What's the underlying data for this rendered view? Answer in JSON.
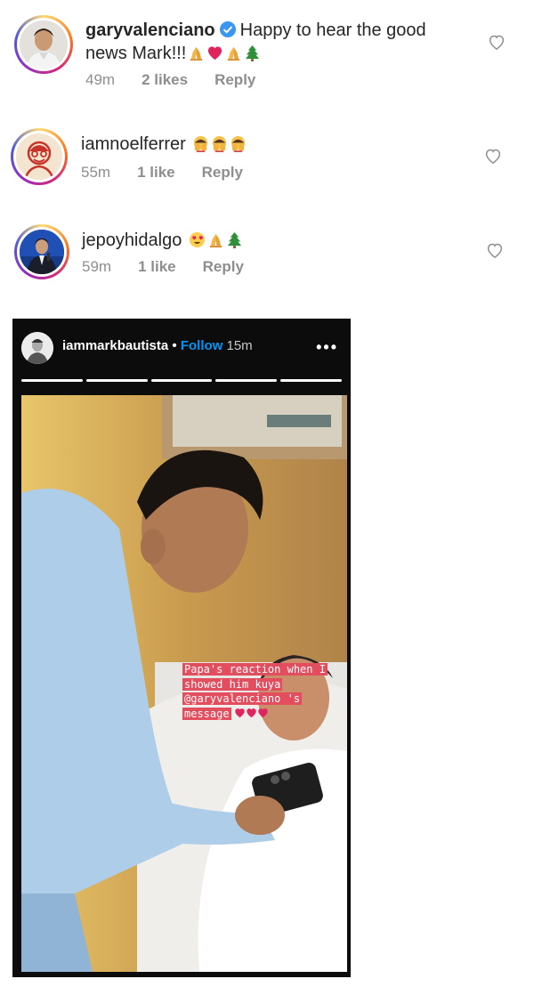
{
  "comments": [
    {
      "username": "garyvalenciano",
      "verified": true,
      "text_line1": "Happy to hear the good",
      "text_line2": "news Mark!!!",
      "time": "49m",
      "likes": "2 likes",
      "reply": "Reply",
      "emojis": [
        "praying-hands",
        "red-heart",
        "praying-hands",
        "christmas-tree"
      ]
    },
    {
      "username": "iamnoelferrer",
      "verified": false,
      "text": "",
      "time": "55m",
      "likes": "1 like",
      "reply": "Reply",
      "emojis": [
        "hands-covering-face",
        "hands-covering-face",
        "hands-covering-face"
      ]
    },
    {
      "username": "jepoyhidalgo",
      "verified": false,
      "text": "",
      "time": "59m",
      "likes": "1 like",
      "reply": "Reply",
      "emojis": [
        "heart-eyes",
        "praying-hands",
        "christmas-tree"
      ]
    }
  ],
  "story": {
    "username": "iammarkbautista",
    "separator": "•",
    "follow_label": "Follow",
    "time": "15m",
    "more_label": "•••",
    "progress_segments": 5,
    "caption_lines": [
      "Papa's reaction when I",
      "showed him kuya",
      "@garyvalenciano 's",
      "message"
    ],
    "caption_hearts": [
      "red-heart",
      "red-heart",
      "red-heart"
    ]
  },
  "colors": {
    "link_blue": "#0095f6",
    "meta_gray": "#8e8e8e",
    "caption_bg": "#e34e5f",
    "verified_blue": "#3897f0"
  }
}
